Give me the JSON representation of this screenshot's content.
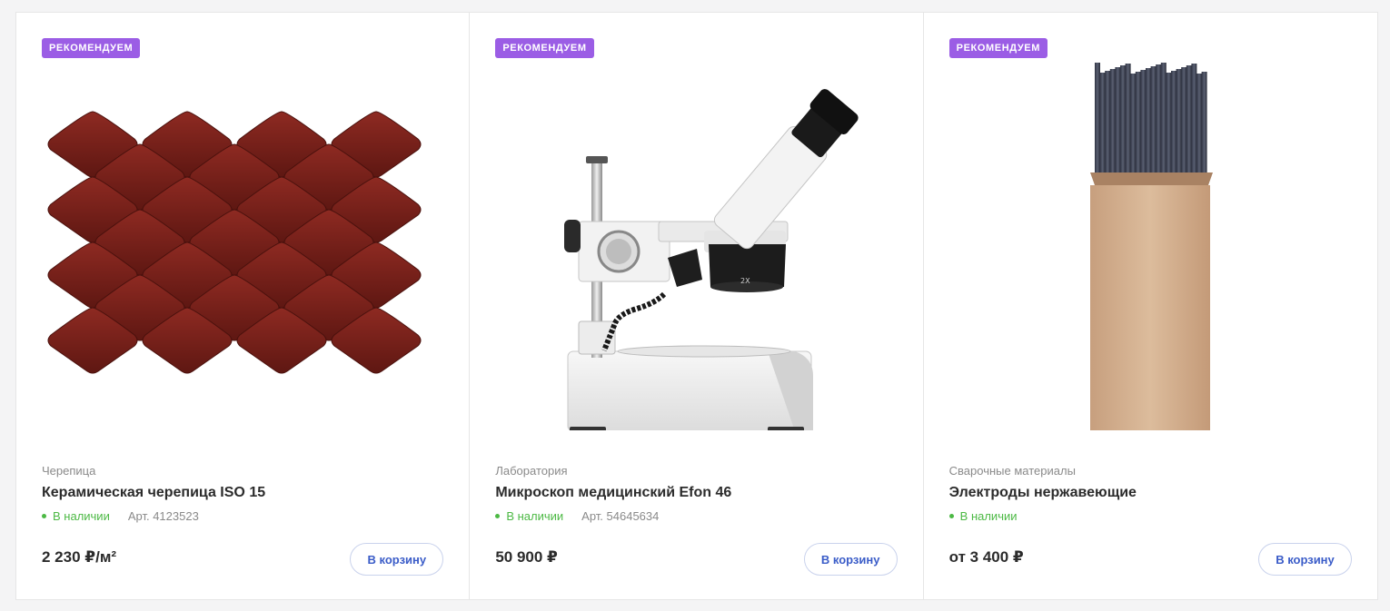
{
  "products": [
    {
      "badge": "РЕКОМЕНДУЕМ",
      "category": "Черепица",
      "title": "Керамическая черепица ISO 15",
      "stock": "В наличии",
      "article": "Арт. 4123523",
      "price": "2 230 ₽/м²",
      "button": "В корзину",
      "image_icon": "roof-tile-icon"
    },
    {
      "badge": "РЕКОМЕНДУЕМ",
      "category": "Лаборатория",
      "title": "Микроскоп медицинский Efon 46",
      "stock": "В наличии",
      "article": "Арт. 54645634",
      "price": "50 900 ₽",
      "button": "В корзину",
      "image_icon": "microscope-icon"
    },
    {
      "badge": "РЕКОМЕНДУЕМ",
      "category": "Сварочные материалы",
      "title": "Электроды нержавеющие",
      "stock": "В наличии",
      "article": "",
      "price": "от 3 400 ₽",
      "button": "В корзину",
      "image_icon": "electrodes-box-icon"
    }
  ],
  "colors": {
    "badge": "#9b5de5",
    "in_stock": "#4cb944",
    "button_text": "#3a5cc8"
  }
}
